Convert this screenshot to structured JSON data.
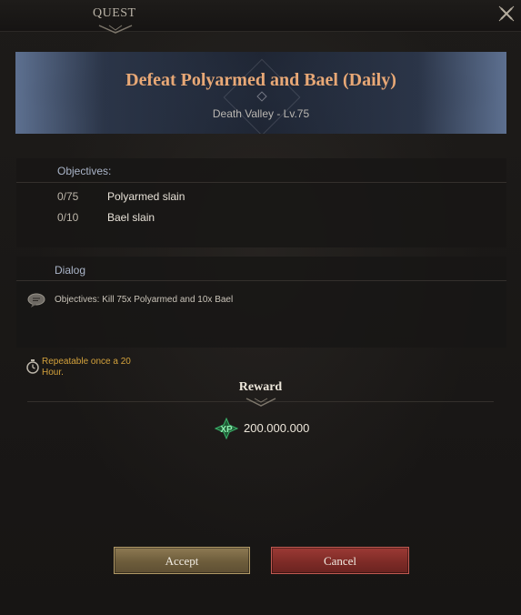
{
  "window": {
    "title": "QUEST"
  },
  "banner": {
    "quest_name": "Defeat Polyarmed and Bael (Daily)",
    "location": "Death Valley - Lv.75"
  },
  "objectives": {
    "heading": "Objectives:",
    "items": [
      {
        "progress": "0/75",
        "label": "Polyarmed slain"
      },
      {
        "progress": "0/10",
        "label": "Bael slain"
      }
    ]
  },
  "dialog": {
    "heading": "Dialog",
    "text": "Objectives: Kill 75x Polyarmed and 10x Bael"
  },
  "repeatable": {
    "text": "Repeatable once a 20 Hour."
  },
  "reward": {
    "heading": "Reward",
    "xp_icon_label": "XP",
    "xp_value": "200.000.000"
  },
  "buttons": {
    "accept": "Accept",
    "cancel": "Cancel"
  },
  "colors": {
    "quest_title": "#e8a876",
    "accept": "#7a6a48",
    "cancel": "#8a302c",
    "repeat_text": "#d4a23c",
    "xp_icon": "#3bb36b"
  },
  "icons": {
    "close": "close-icon",
    "chat": "chat-bubble-icon",
    "timer": "stopwatch-icon",
    "xp": "xp-icon"
  }
}
